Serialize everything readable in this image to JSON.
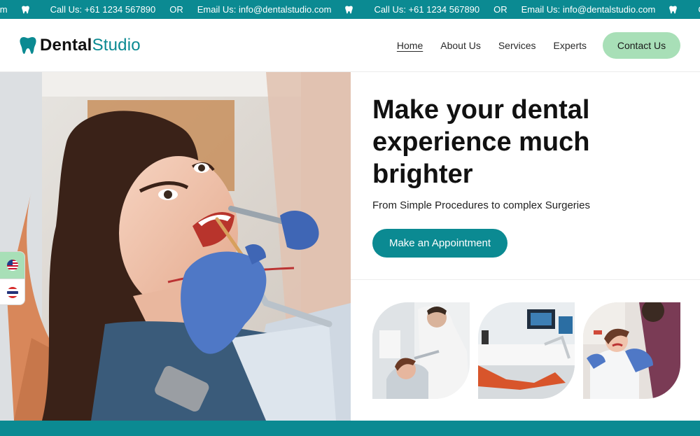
{
  "topbar": {
    "items": [
      {
        "type": "text",
        "text": "com"
      },
      {
        "type": "tooth"
      },
      {
        "type": "text",
        "text": "Call Us: +61 1234 567890"
      },
      {
        "type": "text",
        "text": "OR"
      },
      {
        "type": "text",
        "text": "Email Us: info@dentalstudio.com"
      },
      {
        "type": "tooth"
      },
      {
        "type": "text",
        "text": "Call Us: +61 1234 567890"
      },
      {
        "type": "text",
        "text": "OR"
      },
      {
        "type": "text",
        "text": "Email Us: info@dentalstudio.com"
      },
      {
        "type": "tooth"
      },
      {
        "type": "text",
        "text": "Call Us"
      }
    ],
    "color": "#0b8a92"
  },
  "header": {
    "logo": {
      "part1": "Dental",
      "part2": "Studio",
      "icon": "tooth-icon"
    },
    "nav": [
      {
        "label": "Home",
        "active": true
      },
      {
        "label": "About Us",
        "active": false
      },
      {
        "label": "Services",
        "active": false
      },
      {
        "label": "Experts",
        "active": false
      }
    ],
    "contact_label": "Contact Us",
    "contact_color": "#a8dfb7"
  },
  "hero": {
    "title": "Make your dental experience much brighter",
    "subtitle": "From Simple Procedures to complex Surgeries",
    "cta_label": "Make an Appointment"
  },
  "language": {
    "options": [
      {
        "icon": "us-flag-icon",
        "active": true
      },
      {
        "icon": "thai-flag-icon",
        "active": false
      }
    ]
  },
  "colors": {
    "accent": "#0b8a92",
    "green": "#a8dfb7"
  }
}
